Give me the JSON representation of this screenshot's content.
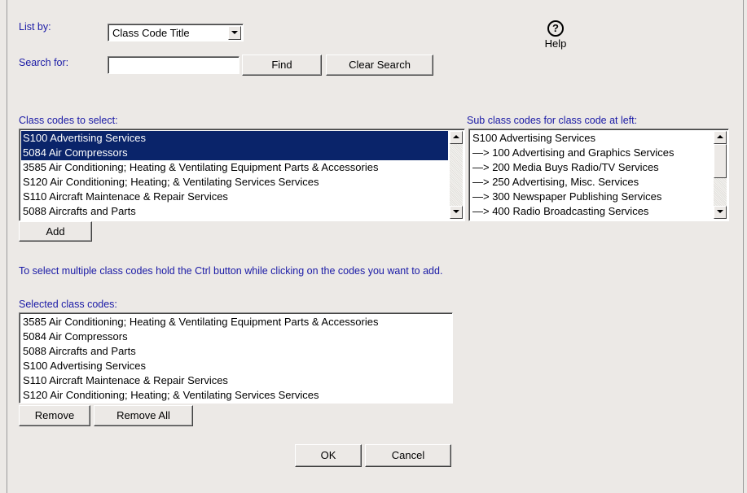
{
  "list_by": {
    "label": "List by:",
    "selected": "Class Code Title"
  },
  "search": {
    "label": "Search for:",
    "value": "",
    "find_label": "Find",
    "clear_label": "Clear Search"
  },
  "help": {
    "glyph": "?",
    "label": "Help"
  },
  "class_codes": {
    "label": "Class codes to select:",
    "items": [
      {
        "text": "S100 Advertising Services",
        "selected": true
      },
      {
        "text": "5084 Air Compressors",
        "selected": true
      },
      {
        "text": "3585 Air Conditioning; Heating & Ventilating Equipment Parts & Accessories",
        "selected": false
      },
      {
        "text": "S120 Air Conditioning; Heating; & Ventilating Services Services",
        "selected": false
      },
      {
        "text": "S110 Aircraft Maintenace & Repair Services",
        "selected": false
      },
      {
        "text": "5088 Aircrafts and Parts",
        "selected": false
      }
    ]
  },
  "sub_codes": {
    "label": "Sub class codes for class code at left:",
    "items": [
      "S100 Advertising Services",
      "—> 100 Advertising and Graphics Services",
      "—> 200 Media Buys Radio/TV Services",
      "—> 250 Advertising, Misc. Services",
      "—> 300 Newspaper Publishing Services",
      "—> 400 Radio Broadcasting Services"
    ]
  },
  "add_label": "Add",
  "instruction": "To select multiple class codes hold the Ctrl button while clicking on the codes you want to add.",
  "selected_codes": {
    "label": "Selected class codes:",
    "items": [
      "3585 Air Conditioning; Heating & Ventilating Equipment Parts & Accessories",
      "5084 Air Compressors",
      "5088 Aircrafts and Parts",
      "S100 Advertising Services",
      "S110 Aircraft Maintenace & Repair Services",
      "S120 Air Conditioning; Heating; & Ventilating Services Services"
    ]
  },
  "remove_label": "Remove",
  "remove_all_label": "Remove All",
  "ok_label": "OK",
  "cancel_label": "Cancel",
  "colors": {
    "label": "#1a1aa6",
    "selection": "#0a246a",
    "background": "#ece9e6"
  }
}
